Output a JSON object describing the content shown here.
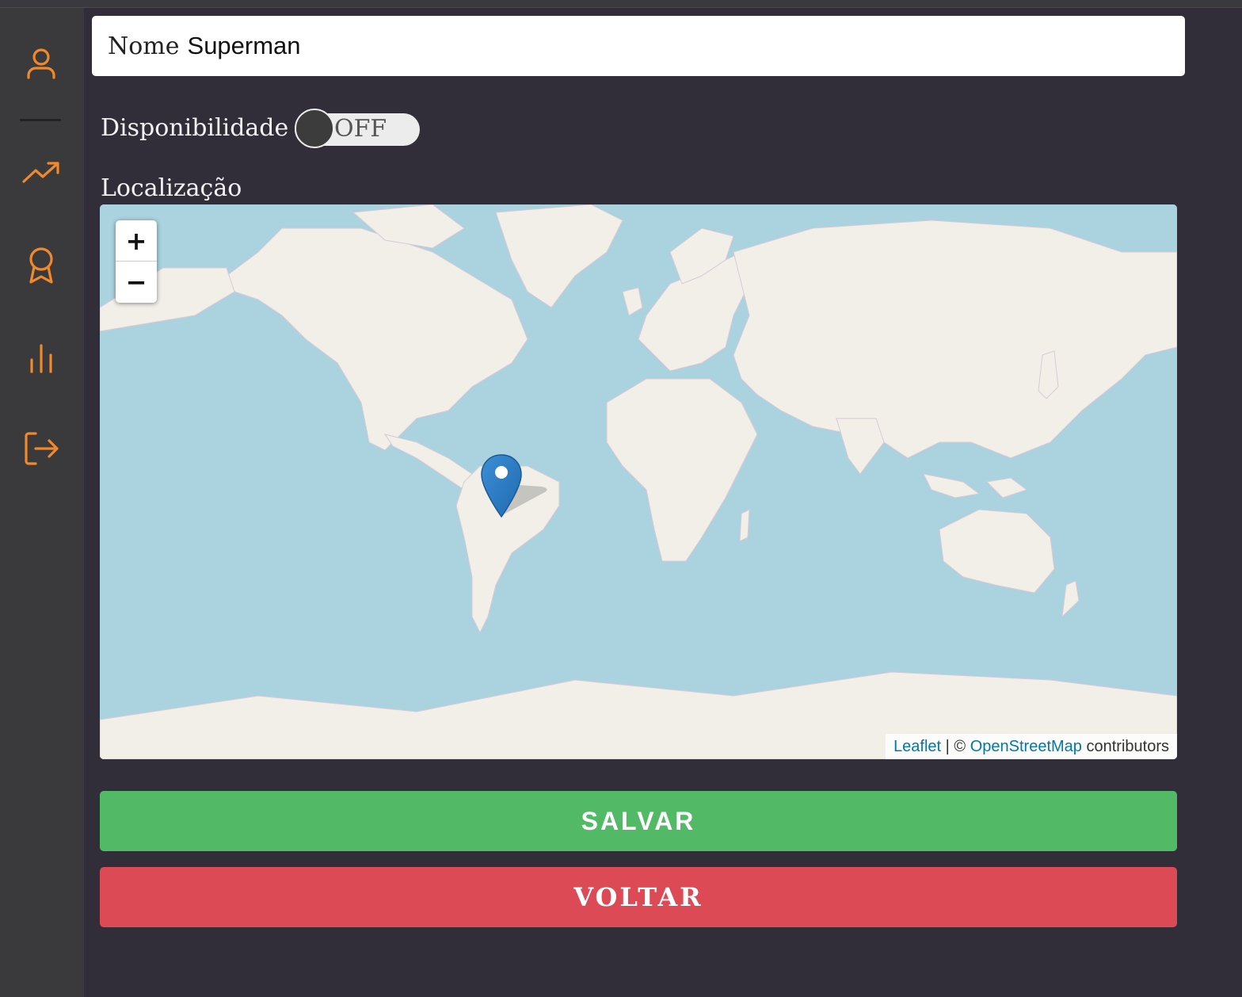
{
  "sidebar": {
    "accent_color": "#f0892b",
    "items": [
      {
        "icon": "user-icon"
      },
      {
        "icon": "trending-up-icon"
      },
      {
        "icon": "award-icon"
      },
      {
        "icon": "bar-chart-icon"
      },
      {
        "icon": "logout-icon"
      }
    ]
  },
  "form": {
    "name_label": "Nome",
    "name_value": "Superman",
    "availability_label": "Disponibilidade",
    "availability_toggle": "OFF",
    "location_label": "Localização"
  },
  "map": {
    "zoom_in": "+",
    "zoom_out": "−",
    "attribution_leaflet": "Leaflet",
    "attribution_sep": " | © ",
    "attribution_osm": "OpenStreetMap",
    "attribution_suffix": " contributors",
    "marker_icon": "map-pin-icon",
    "water_color": "#aad3df",
    "land_color": "#f2efe9"
  },
  "actions": {
    "save_label": "SALVAR",
    "back_label": "VOLTAR",
    "save_color": "#52ba66",
    "back_color": "#db4a55"
  }
}
